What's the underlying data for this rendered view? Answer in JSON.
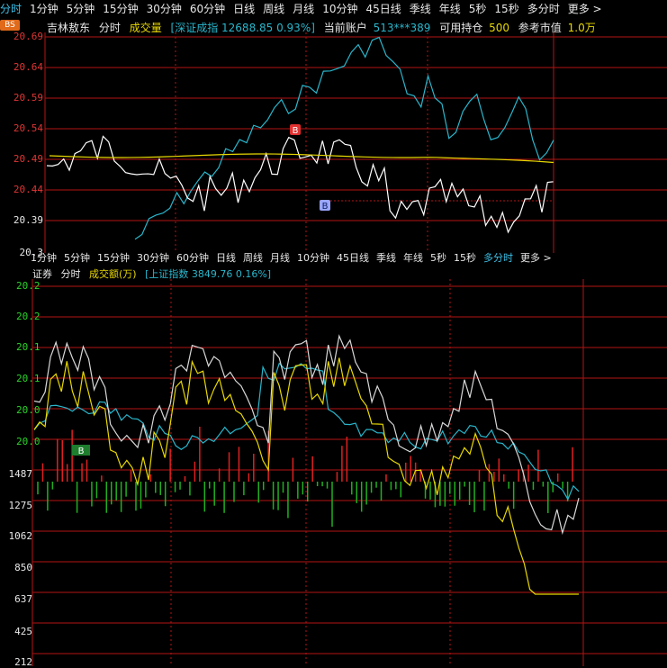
{
  "top": {
    "tabs": [
      "分时",
      "1分钟",
      "5分钟",
      "15分钟",
      "30分钟",
      "60分钟",
      "日线",
      "周线",
      "月线",
      "10分钟",
      "45日线",
      "季线",
      "年线",
      "5秒",
      "15秒",
      "多分时",
      "更多 >"
    ],
    "active_tab": "分时",
    "bs_badge": "BS",
    "info": {
      "stock_name": "吉林敖东",
      "period": "分时",
      "indicator": "成交量",
      "index_text": "[深证成指 12688.85 0.93%]",
      "account_label": "当前账户",
      "account_value": "513***389",
      "holding_label": "可用持仓",
      "holding_value": "500",
      "ref_label": "参考市值",
      "ref_value": "1.0万"
    },
    "y_labels": [
      "20.69",
      "20.64",
      "20.59",
      "20.54",
      "20.49",
      "20.44",
      "20.39",
      "20.3"
    ],
    "markers": {
      "buy_red": "B",
      "buy_blue": "B"
    }
  },
  "bottom": {
    "tabs": [
      "1分钟",
      "5分钟",
      "15分钟",
      "30分钟",
      "60分钟",
      "日线",
      "周线",
      "月线",
      "10分钟",
      "45日线",
      "季线",
      "年线",
      "5秒",
      "15秒",
      "多分时",
      "更多 >"
    ],
    "active_tab": "多分时",
    "info": {
      "name": "证券",
      "period": "分时",
      "indicator": "成交额(万)",
      "index_text": "[上证指数 3849.76 0.16%]"
    },
    "price_labels": [
      "20.2",
      "20.2",
      "20.1",
      "20.1",
      "20.0",
      "20.0"
    ],
    "volume_labels": [
      "1487",
      "1275",
      "1062",
      "850",
      "637",
      "425",
      "212"
    ],
    "marker": "B"
  },
  "colors": {
    "grid": "#b41414",
    "price_line": "#ffffff",
    "avg_line": "#e8d800",
    "index_line": "#29b6cc",
    "vol_up": "#e02020",
    "vol_down": "#20b020",
    "tab_active": "#3cc0e8"
  }
}
